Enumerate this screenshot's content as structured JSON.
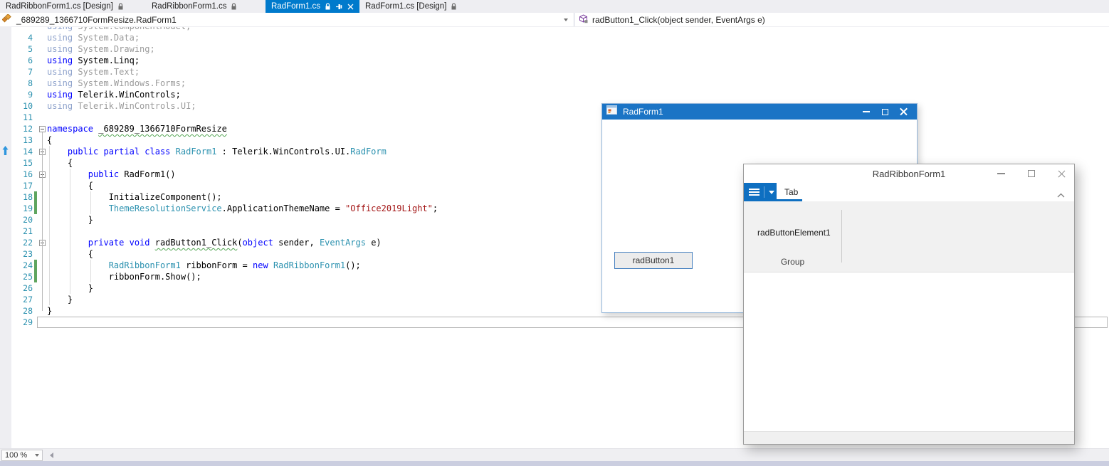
{
  "colors": {
    "accent": "#007ACC",
    "keyword": "#0000FF",
    "type": "#2B91AF",
    "string": "#A31515",
    "faded": "#9B9B9B",
    "faded_kw": "#8FA3CC",
    "linenum": "#2B91AF",
    "change_bar": "#5FA55F",
    "squiggle": "#53A653",
    "form_titlebar": "#1B74C5",
    "ribbon_accent": "#0E6FC1",
    "status_strip": "#CBCEE0"
  },
  "tabbar": {
    "tabs": [
      {
        "label": "RadRibbonForm1.cs [Design]",
        "icons": [
          "lock"
        ],
        "active": false
      },
      {
        "label": "RadRibbonForm1.cs",
        "icons": [
          "lock"
        ],
        "active": false
      },
      {
        "label": "RadForm1.cs",
        "icons": [
          "lock",
          "pin",
          "close"
        ],
        "active": true
      },
      {
        "label": "RadForm1.cs [Design]",
        "icons": [
          "lock"
        ],
        "active": false
      }
    ]
  },
  "navbar": {
    "left_text": "_689289_1366710FormResize.RadForm1",
    "right_text": "radButton1_Click(object sender, EventArgs e)"
  },
  "editor": {
    "zoom_label": "100 %",
    "lines": [
      {
        "n": "",
        "seg": [
          {
            "t": "using",
            "c": "fkw"
          },
          {
            "t": " System.ComponentModel;",
            "c": "faded"
          }
        ]
      },
      {
        "n": 4,
        "seg": [
          {
            "t": "using",
            "c": "fkw"
          },
          {
            "t": " System.Data;",
            "c": "faded"
          }
        ]
      },
      {
        "n": 5,
        "seg": [
          {
            "t": "using",
            "c": "fkw"
          },
          {
            "t": " System.Drawing;",
            "c": "faded"
          }
        ]
      },
      {
        "n": 6,
        "seg": [
          {
            "t": "using",
            "c": "kw"
          },
          {
            "t": " System.Linq;",
            "c": ""
          }
        ]
      },
      {
        "n": 7,
        "seg": [
          {
            "t": "using",
            "c": "fkw"
          },
          {
            "t": " System.Text;",
            "c": "faded"
          }
        ]
      },
      {
        "n": 8,
        "seg": [
          {
            "t": "using",
            "c": "fkw"
          },
          {
            "t": " System.Windows.Forms;",
            "c": "faded"
          }
        ]
      },
      {
        "n": 9,
        "seg": [
          {
            "t": "using",
            "c": "kw"
          },
          {
            "t": " Telerik.WinControls;",
            "c": ""
          }
        ]
      },
      {
        "n": 10,
        "seg": [
          {
            "t": "using",
            "c": "fkw"
          },
          {
            "t": " Telerik.WinControls.UI;",
            "c": "faded"
          }
        ]
      },
      {
        "n": 11,
        "seg": []
      },
      {
        "n": 12,
        "fold": true,
        "seg": [
          {
            "t": "namespace",
            "c": "kw"
          },
          {
            "t": " ",
            "c": ""
          },
          {
            "t": "_689289_1366710FormResize",
            "c": "sq"
          }
        ]
      },
      {
        "n": 13,
        "seg": [
          {
            "t": "{",
            "c": ""
          }
        ]
      },
      {
        "n": 14,
        "fold": true,
        "seg": [
          {
            "t": "    ",
            "c": ""
          },
          {
            "t": "public partial class",
            "c": "kw"
          },
          {
            "t": " ",
            "c": ""
          },
          {
            "t": "RadForm1",
            "c": "type"
          },
          {
            "t": " : Telerik.WinControls.UI.",
            "c": ""
          },
          {
            "t": "RadForm",
            "c": "type"
          }
        ]
      },
      {
        "n": 15,
        "seg": [
          {
            "t": "    {",
            "c": ""
          }
        ]
      },
      {
        "n": 16,
        "fold": true,
        "seg": [
          {
            "t": "        ",
            "c": ""
          },
          {
            "t": "public",
            "c": "kw"
          },
          {
            "t": " RadForm1()",
            "c": ""
          }
        ]
      },
      {
        "n": 17,
        "seg": [
          {
            "t": "        {",
            "c": ""
          }
        ]
      },
      {
        "n": 18,
        "chg": true,
        "seg": [
          {
            "t": "            InitializeComponent();",
            "c": ""
          }
        ]
      },
      {
        "n": 19,
        "chg": true,
        "seg": [
          {
            "t": "            ",
            "c": ""
          },
          {
            "t": "ThemeResolutionService",
            "c": "type"
          },
          {
            "t": ".ApplicationThemeName = ",
            "c": ""
          },
          {
            "t": "\"Office2019Light\"",
            "c": "str"
          },
          {
            "t": ";",
            "c": ""
          }
        ]
      },
      {
        "n": 20,
        "seg": [
          {
            "t": "        }",
            "c": ""
          }
        ]
      },
      {
        "n": 21,
        "seg": []
      },
      {
        "n": 22,
        "fold": true,
        "seg": [
          {
            "t": "        ",
            "c": ""
          },
          {
            "t": "private void",
            "c": "kw"
          },
          {
            "t": " ",
            "c": ""
          },
          {
            "t": "radButton1_Click",
            "c": "sq"
          },
          {
            "t": "(",
            "c": ""
          },
          {
            "t": "object",
            "c": "kw"
          },
          {
            "t": " sender, ",
            "c": ""
          },
          {
            "t": "EventArgs",
            "c": "type"
          },
          {
            "t": " e)",
            "c": ""
          }
        ]
      },
      {
        "n": 23,
        "seg": [
          {
            "t": "        {",
            "c": ""
          }
        ]
      },
      {
        "n": 24,
        "chg": true,
        "seg": [
          {
            "t": "            ",
            "c": ""
          },
          {
            "t": "RadRibbonForm1",
            "c": "type"
          },
          {
            "t": " ribbonForm = ",
            "c": ""
          },
          {
            "t": "new",
            "c": "kw"
          },
          {
            "t": " ",
            "c": ""
          },
          {
            "t": "RadRibbonForm1",
            "c": "type"
          },
          {
            "t": "();",
            "c": ""
          }
        ]
      },
      {
        "n": 25,
        "chg": true,
        "seg": [
          {
            "t": "            ribbonForm.Show();",
            "c": ""
          }
        ]
      },
      {
        "n": 26,
        "seg": [
          {
            "t": "        }",
            "c": ""
          }
        ]
      },
      {
        "n": 27,
        "seg": [
          {
            "t": "    }",
            "c": ""
          }
        ]
      },
      {
        "n": 28,
        "seg": [
          {
            "t": "}",
            "c": ""
          }
        ]
      },
      {
        "n": 29,
        "cur": true,
        "seg": []
      }
    ]
  },
  "radform_window": {
    "title": "RadForm1",
    "button_label": "radButton1"
  },
  "ribbon_window": {
    "title": "RadRibbonForm1",
    "tab_label": "Tab",
    "button_element_label": "radButtonElement1",
    "group_label": "Group"
  }
}
